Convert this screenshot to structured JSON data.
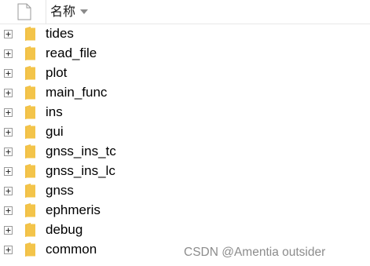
{
  "header": {
    "column_title": "名称"
  },
  "folders": [
    {
      "name": "tides"
    },
    {
      "name": "read_file"
    },
    {
      "name": "plot"
    },
    {
      "name": "main_func"
    },
    {
      "name": "ins"
    },
    {
      "name": "gui"
    },
    {
      "name": "gnss_ins_tc"
    },
    {
      "name": "gnss_ins_lc"
    },
    {
      "name": "gnss"
    },
    {
      "name": "ephmeris"
    },
    {
      "name": "debug"
    },
    {
      "name": "common"
    }
  ],
  "watermark": "CSDN @Amentia outsider",
  "colors": {
    "folder_fill": "#f3c44a",
    "folder_edge": "#d9a82e",
    "expander_border": "#9a9a9a"
  }
}
